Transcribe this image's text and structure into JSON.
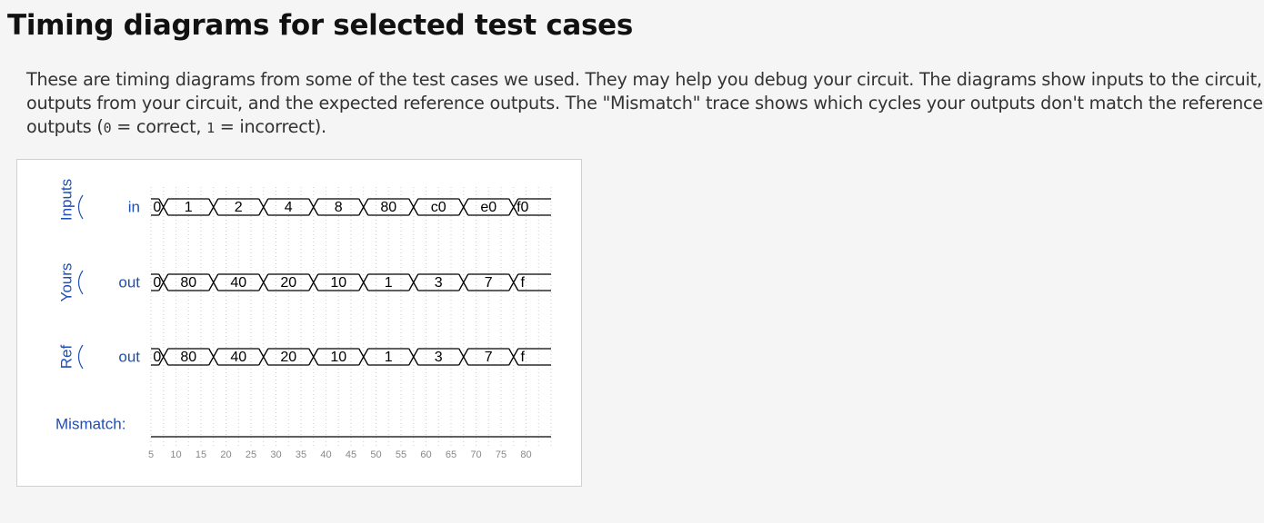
{
  "page": {
    "title": "Timing diagrams for selected test cases",
    "description": {
      "part1": "These are timing diagrams from some of the test cases we used. They may help you debug your circuit. The diagrams show inputs to the circuit, outputs from your circuit, and the expected reference outputs. The \"Mismatch\" trace shows which cycles your outputs don't match the reference outputs (",
      "code0": "0",
      "part2": " = correct, ",
      "code1": "1",
      "part3": " = incorrect)."
    }
  },
  "diagram": {
    "groups": [
      {
        "label": "Inputs",
        "signal": "in"
      },
      {
        "label": "Yours",
        "signal": "out"
      },
      {
        "label": "Ref",
        "signal": "out"
      }
    ],
    "mismatch_label": "Mismatch:",
    "traces": [
      {
        "values": [
          "0",
          "1",
          "2",
          "4",
          "8",
          "80",
          "c0",
          "e0",
          "f0"
        ]
      },
      {
        "values": [
          "0",
          "80",
          "40",
          "20",
          "10",
          "1",
          "3",
          "7",
          "f"
        ]
      },
      {
        "values": [
          "0",
          "80",
          "40",
          "20",
          "10",
          "1",
          "3",
          "7",
          "f"
        ]
      }
    ],
    "time_ticks": [
      "5",
      "10",
      "15",
      "20",
      "25",
      "30",
      "35",
      "40",
      "45",
      "50",
      "55",
      "60",
      "65",
      "70",
      "75",
      "80"
    ],
    "colors": {
      "label_blue": "#1f4fb4",
      "tick_gray": "#888888",
      "wave": "#000000",
      "grid": "#cccccc"
    }
  }
}
